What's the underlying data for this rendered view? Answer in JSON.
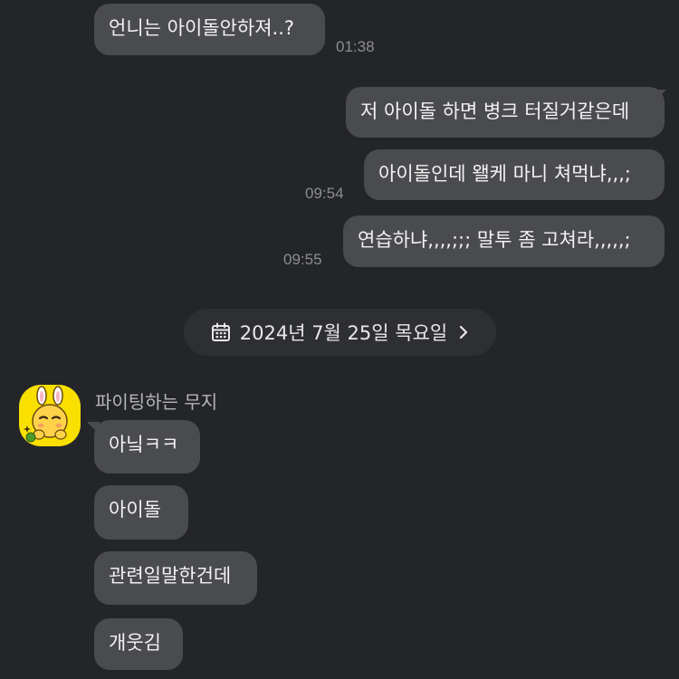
{
  "messages_top": [
    {
      "text": "언니는 아이돌안하져..?",
      "time": "01:38"
    },
    {
      "text": "저 아이돌 하면 병크 터질거같은데",
      "time": ""
    },
    {
      "text": "아이돌인데 왤케 마니 쳐먹냐,,,;",
      "time": "09:54"
    },
    {
      "text": "연습하냐,,,,;;; 말투 좀 고쳐라,,,,,;",
      "time": "09:55"
    }
  ],
  "date_separator": {
    "label": "2024년 7월 25일 목요일",
    "icon": "calendar-icon",
    "chevron": "chevron-right-icon"
  },
  "sender": {
    "name": "파이팅하는 무지",
    "avatar": "muzi-avatar",
    "avatar_color": "#f9e000"
  },
  "messages_bottom": [
    {
      "text": "아닠ㅋㅋ"
    },
    {
      "text": "아이돌"
    },
    {
      "text": "관련일말한건데"
    },
    {
      "text": "개웃김"
    }
  ],
  "colors": {
    "background": "#242528",
    "bubble": "#4a4b4f",
    "time": "#8c8d91"
  }
}
